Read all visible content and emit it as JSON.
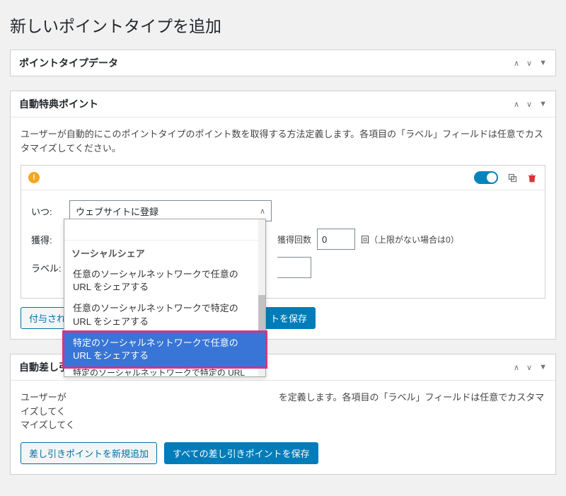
{
  "page_title": "新しいポイントタイプを追加",
  "panel1": {
    "title": "ポイントタイプデータ"
  },
  "panel2": {
    "title": "自動特典ポイント",
    "desc": "ユーザーが自動的にこのポイントタイプのポイント数を取得する方法定義します。各項目の「ラベル」フィールドは任意でカスタマイズしてください。",
    "fields": {
      "when_label": "いつ:",
      "when_value": "ウェブサイトに登録",
      "earn_label": "獲得:",
      "max_label": "獲得回数",
      "max_value": "0",
      "max_suffix": "回（上限がない場合は0）",
      "label_label": "ラベル:"
    },
    "add_button": "付与された",
    "save_button": "トを保存"
  },
  "dropdown": {
    "group": "ソーシャルシェア",
    "opt1": "任意のソーシャルネットワークで任意の URL をシェアする",
    "opt2": "任意のソーシャルネットワークで特定の URL をシェアする",
    "opt3": "特定のソーシャルネットワークで任意の URL をシェアする",
    "opt4_peek": "特定のソーシャルネットワークで特定の URL"
  },
  "panel3": {
    "title": "自動差し引",
    "desc_prefix": "ユーザーが",
    "desc_suffix": "を定義します。各項目の「ラベル」フィールドは任意でカスタマイズしてく",
    "desc_line2": "マイズしてく",
    "add_button": "差し引きポイントを新規追加",
    "save_button": "すべての差し引きポイントを保存"
  }
}
